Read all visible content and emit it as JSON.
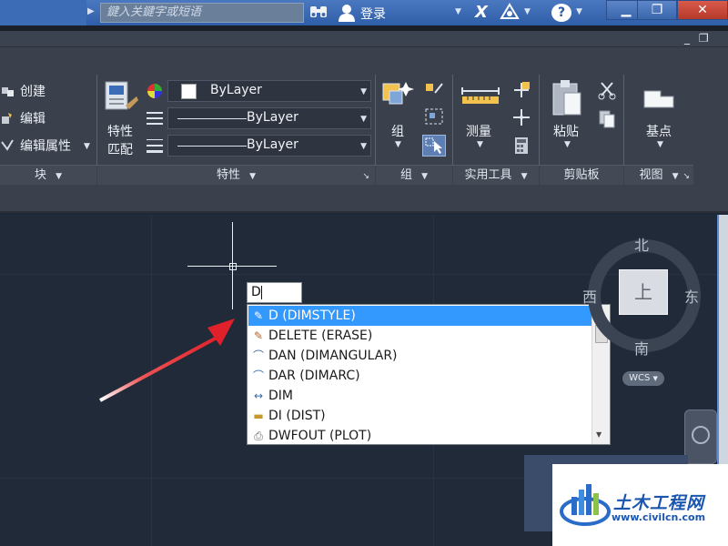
{
  "titlebar": {
    "search_placeholder": "鍵入关鍵字或短语",
    "login_label": "登录",
    "help_label": "?",
    "minimize_glyph": "▁",
    "maximize_glyph": "❐",
    "close_glyph": "✕"
  },
  "ribbon": {
    "block_panel": {
      "items": [
        "创建",
        "编辑",
        "编辑属性"
      ],
      "title": "块"
    },
    "properties_panel": {
      "match_label_line1": "特性",
      "match_label_line2": "匹配",
      "color_value": "ByLayer",
      "linetype_value": "ByLayer",
      "lineweight_value": "ByLayer",
      "title": "特性"
    },
    "group_panel": {
      "group_label": "组",
      "title": "组"
    },
    "utilities_panel": {
      "measure_label": "测量",
      "title": "实用工具"
    },
    "clipboard_panel": {
      "paste_label": "粘贴",
      "title": "剪贴板"
    },
    "view_panel": {
      "basepoint_label": "基点",
      "title": "视图"
    }
  },
  "command": {
    "input_value": "D"
  },
  "autocomplete": {
    "items": [
      {
        "label": "D (DIMSTYLE)",
        "icon": "dimstyle-icon",
        "selected": true
      },
      {
        "label": "DELETE (ERASE)",
        "icon": "erase-icon",
        "selected": false
      },
      {
        "label": "DAN (DIMANGULAR)",
        "icon": "dimangular-icon",
        "selected": false
      },
      {
        "label": "DAR (DIMARC)",
        "icon": "dimarc-icon",
        "selected": false
      },
      {
        "label": "DIM",
        "icon": "dim-icon",
        "selected": false
      },
      {
        "label": "DI (DIST)",
        "icon": "dist-icon",
        "selected": false
      },
      {
        "label": "DWFOUT (PLOT)",
        "icon": "plot-icon",
        "selected": false
      }
    ]
  },
  "viewcube": {
    "north": "北",
    "south": "南",
    "east": "东",
    "west": "西",
    "face": "上",
    "wcs": "WCS"
  },
  "watermark": {
    "title": "土木工程网",
    "url": "www.civilcn.com"
  },
  "colors": {
    "selection": "#3399ff",
    "canvas": "#212a39",
    "titlebar": "#3d6cb6",
    "arrow": "#e0202a"
  }
}
